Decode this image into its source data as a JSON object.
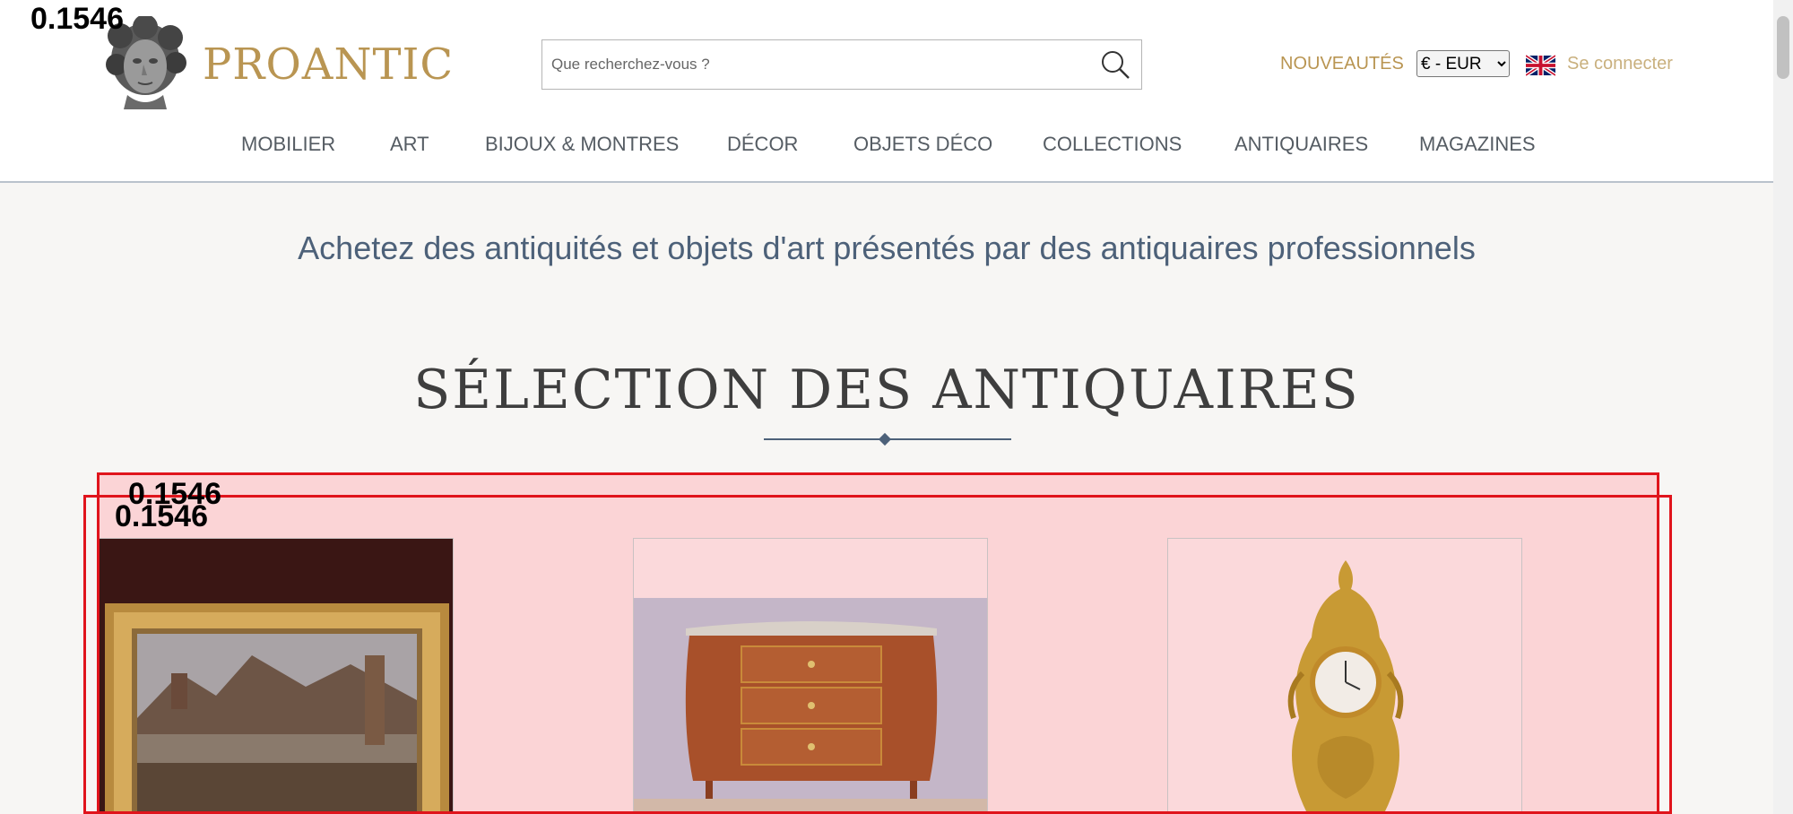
{
  "header": {
    "logo_text": "PROANTIC",
    "search": {
      "placeholder": "Que recherchez-vous ?"
    },
    "nouveautes": "NOUVEAUTÉS",
    "currency": "€ - EUR",
    "language_flag": "uk-flag-icon",
    "login": "Se connecter"
  },
  "nav": {
    "items": [
      "MOBILIER",
      "ART",
      "BIJOUX & MONTRES",
      "DÉCOR",
      "OBJETS DÉCO",
      "COLLECTIONS",
      "ANTIQUAIRES",
      "MAGAZINES"
    ]
  },
  "main": {
    "tagline": "Achetez des antiquités et objets d'art présentés par des antiquaires professionnels",
    "section_title": "SÉLECTION DES ANTIQUAIRES",
    "cards": [
      {
        "icon": "painting-image"
      },
      {
        "icon": "commode-image"
      },
      {
        "icon": "clock-image"
      }
    ]
  },
  "overlay": {
    "labels": [
      "0.1546",
      "0.1546",
      "0.1546"
    ],
    "color": "#e0141c"
  },
  "colors": {
    "brand_gold": "#b99552",
    "nav_text": "#555c63",
    "tagline": "#4d6179"
  }
}
